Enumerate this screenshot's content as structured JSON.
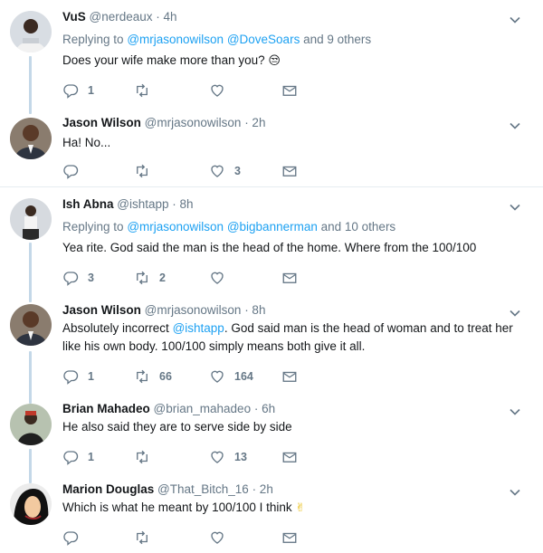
{
  "tweets": [
    {
      "name": "VuS",
      "handle": "@nerdeaux",
      "time": "· 4h",
      "reply_prefix": "Replying to",
      "reply_mention_1": "@mrjasonowilson",
      "reply_mention_2": "@DoveSoars",
      "reply_suffix": "and 9 others",
      "text": "Does your wife make more than you?",
      "emoji": "😒",
      "replies": "1",
      "retweets": "",
      "likes": ""
    },
    {
      "name": "Jason Wilson",
      "handle": "@mrjasonowilson",
      "time": "· 2h",
      "text": "Ha! No...",
      "replies": "",
      "retweets": "",
      "likes": "3"
    },
    {
      "name": "Ish Abna",
      "handle": "@ishtapp",
      "time": "· 8h",
      "reply_prefix": "Replying to",
      "reply_mention_1": "@mrjasonowilson",
      "reply_mention_2": "@bigbannerman",
      "reply_suffix": "and 10 others",
      "text": "Yea rite. God said the man is the head of the home. Where from the 100/100",
      "replies": "3",
      "retweets": "2",
      "likes": ""
    },
    {
      "name": "Jason Wilson",
      "handle": "@mrjasonowilson",
      "time": "· 8h",
      "text_before": "Absolutely incorrect ",
      "text_mention": "@ishtapp",
      "text_after": ". God said man is the head of woman and to treat her like his own body. 100/100 simply means both give it all.",
      "replies": "1",
      "retweets": "66",
      "likes": "164"
    },
    {
      "name": "Brian Mahadeo",
      "handle": "@brian_mahadeo",
      "time": "· 6h",
      "text": "He also said they are to serve side by side",
      "replies": "1",
      "retweets": "",
      "likes": "13"
    },
    {
      "name": "Marion Douglas",
      "handle": "@That_Bitch_16",
      "time": "· 2h",
      "text": "Which is what he meant by 100/100 I think",
      "emoji": "✌",
      "replies": "",
      "retweets": "",
      "likes": ""
    }
  ],
  "colors": {
    "link": "#1da1f2",
    "secondary_text": "#657786",
    "connector": "#c4d8e8",
    "divider": "#e6ecf0"
  },
  "icons": [
    "reply-icon",
    "retweet-icon",
    "like-icon",
    "direct-message-icon",
    "chevron-down-icon"
  ]
}
